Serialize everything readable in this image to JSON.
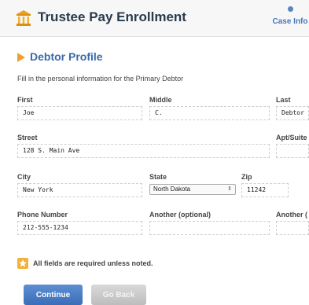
{
  "app": {
    "title": "Trustee Pay Enrollment",
    "case_info_label": "Case Info"
  },
  "section": {
    "title": "Debtor Profile",
    "instructions": "Fill in the personal information for the Primary Debtor"
  },
  "fields": {
    "first": {
      "label": "First",
      "value": "Joe"
    },
    "middle": {
      "label": "Middle",
      "value": "C."
    },
    "last": {
      "label": "Last",
      "value": "Debtor"
    },
    "street": {
      "label": "Street",
      "value": "128 S. Main Ave"
    },
    "apt": {
      "label": "Apt/Suite",
      "value": ""
    },
    "city": {
      "label": "City",
      "value": "New York"
    },
    "state": {
      "label": "State",
      "value": "North Dakota"
    },
    "zip": {
      "label": "Zip",
      "value": "11242"
    },
    "phone": {
      "label": "Phone Number",
      "value": "212-555-1234"
    },
    "another_optional": {
      "label": "Another (optional)",
      "value": ""
    },
    "another_cut": {
      "label": "Another (",
      "value": ""
    }
  },
  "note": {
    "text": "All fields are required unless noted."
  },
  "buttons": {
    "continue": "Continue",
    "go_back": "Go Back"
  },
  "colors": {
    "accent": "#3a6aaa",
    "primary_button": "#4a7cc4",
    "warning": "#f3b13a"
  },
  "icons": {
    "logo": "bank-building-icon",
    "section": "arrow-right-icon",
    "note": "star-icon",
    "select": "updown-caret-icon"
  }
}
